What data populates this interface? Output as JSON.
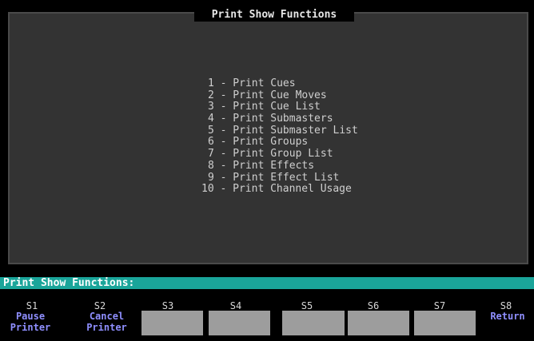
{
  "window": {
    "title": "Print Show Functions"
  },
  "menu": {
    "items": [
      "1 - Print Cues",
      "2 - Print Cue Moves",
      "3 - Print Cue List",
      "4 - Print Submasters",
      "5 - Print Submaster List",
      "6 - Print Groups",
      "7 - Print Group List",
      "8 - Print Effects",
      "9 - Print Effect List",
      "10 - Print Channel Usage"
    ]
  },
  "status": {
    "text": "Print Show Functions:"
  },
  "softkeys": [
    {
      "key": "S1",
      "line1": "Pause",
      "line2": "Printer"
    },
    {
      "key": "S2",
      "line1": "Cancel",
      "line2": "Printer"
    },
    {
      "key": "S3",
      "line1": "",
      "line2": ""
    },
    {
      "key": "S4",
      "line1": "",
      "line2": ""
    },
    {
      "key": "S5",
      "line1": "",
      "line2": ""
    },
    {
      "key": "S6",
      "line1": "",
      "line2": ""
    },
    {
      "key": "S7",
      "line1": "",
      "line2": ""
    },
    {
      "key": "S8",
      "line1": "Return",
      "line2": ""
    }
  ]
}
